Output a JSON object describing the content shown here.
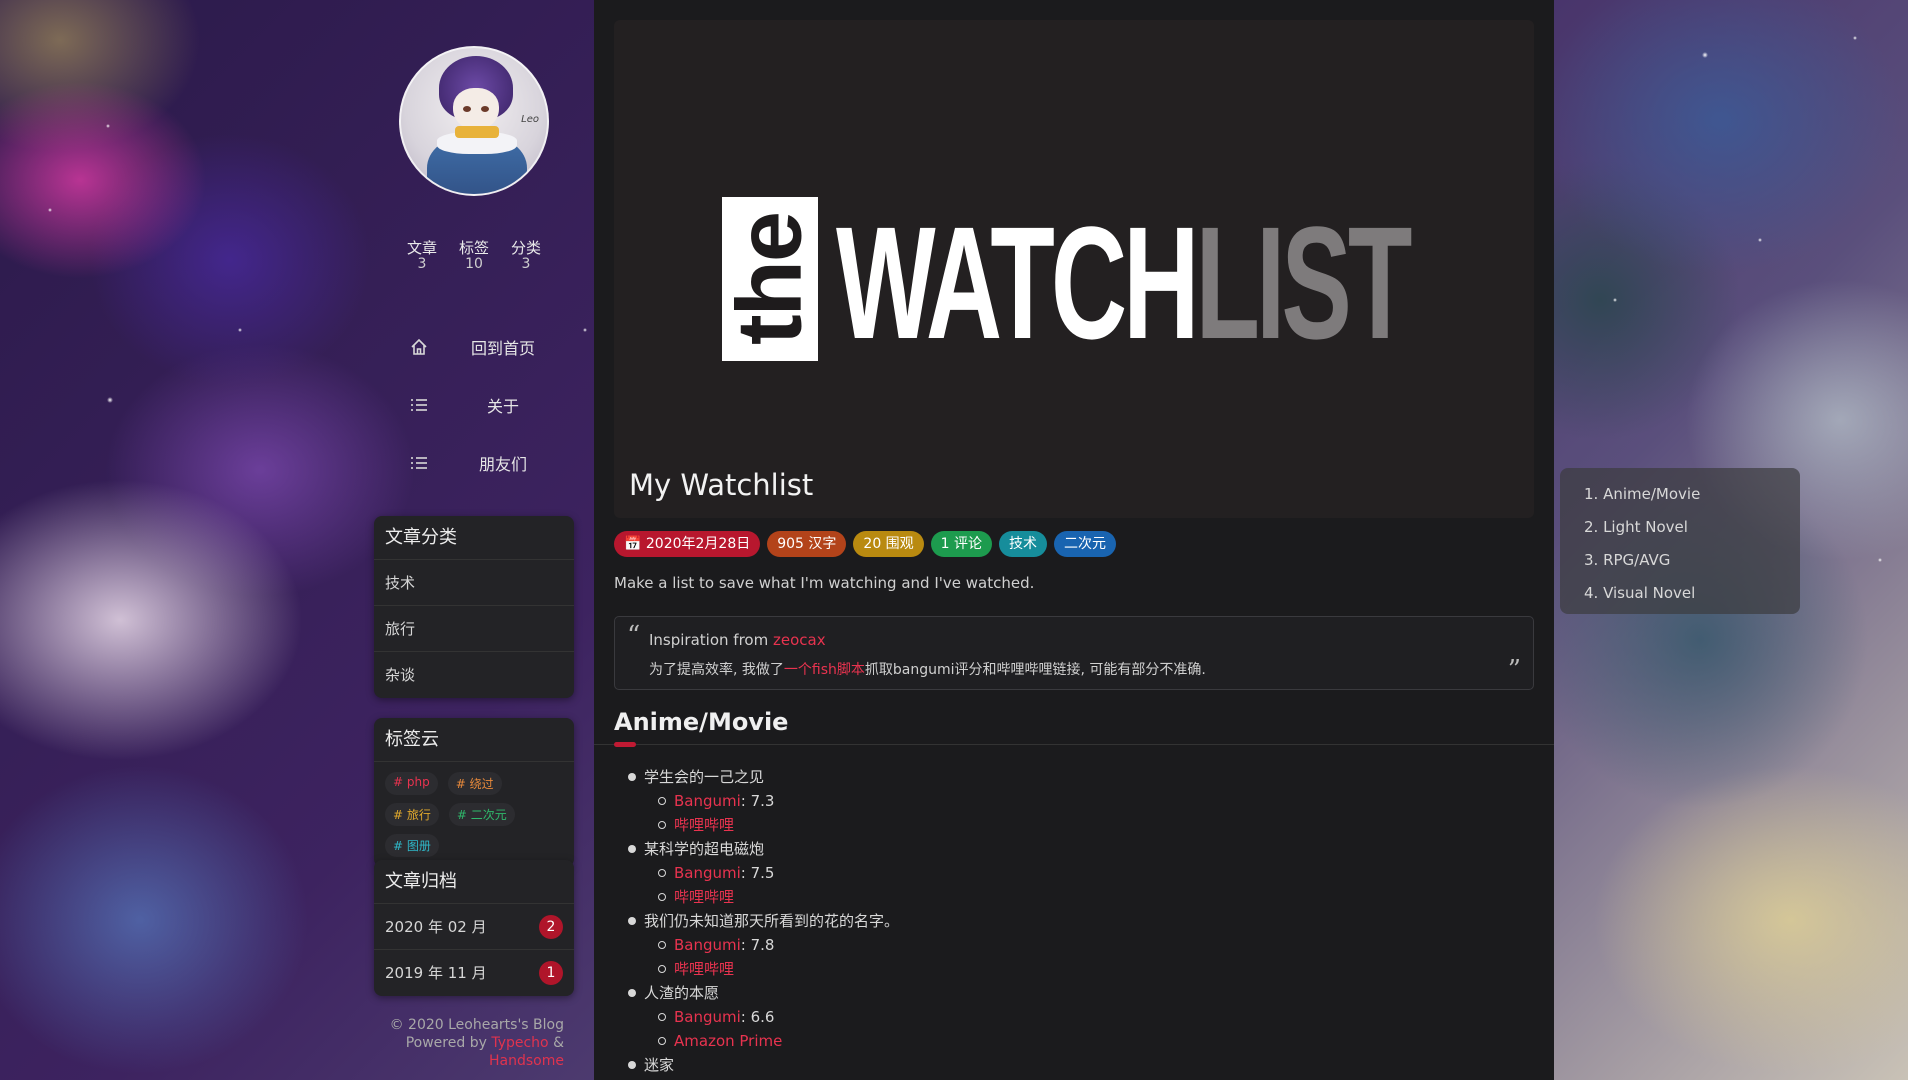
{
  "sidebar": {
    "stats": [
      {
        "label": "文章",
        "value": "3"
      },
      {
        "label": "标签",
        "value": "10"
      },
      {
        "label": "分类",
        "value": "3"
      }
    ],
    "menu": [
      {
        "label": "回到首页",
        "icon": "home-icon"
      },
      {
        "label": "关于",
        "icon": "list-icon"
      },
      {
        "label": "朋友们",
        "icon": "list-icon"
      }
    ],
    "categories": {
      "title": "文章分类",
      "items": [
        "技术",
        "旅行",
        "杂谈"
      ]
    },
    "tags": {
      "title": "标签云",
      "items": [
        {
          "label": "# php",
          "color": "#e8334f"
        },
        {
          "label": "# 绕过",
          "color": "#e98a3b"
        },
        {
          "label": "# 旅行",
          "color": "#e0a92c"
        },
        {
          "label": "# 二次元",
          "color": "#2fb86b"
        },
        {
          "label": "# 图册",
          "color": "#2fb7c8"
        }
      ]
    },
    "archive": {
      "title": "文章归档",
      "items": [
        {
          "label": "2020 年 02 月",
          "count": "2"
        },
        {
          "label": "2019 年 11 月",
          "count": "1"
        }
      ]
    },
    "footer": {
      "line1": "© 2020 Leohearts's Blog",
      "powered": "Powered by",
      "typecho": "Typecho",
      "amp": "&",
      "handsome": "Handsome"
    }
  },
  "post": {
    "hero": {
      "the": "the",
      "watch": "WATCH",
      "list": "LIST"
    },
    "title": "My Watchlist",
    "chips": [
      {
        "label": "📅 2020年2月28日",
        "color": "#b8172e"
      },
      {
        "label": "905 汉字",
        "color": "#b3431a"
      },
      {
        "label": "20 围观",
        "color": "#b98a10"
      },
      {
        "label": "1 评论",
        "color": "#1d9b4e"
      },
      {
        "label": "技术",
        "color": "#168d9b"
      },
      {
        "label": "二次元",
        "color": "#1964b0"
      }
    ],
    "description": "Make a list to save what I'm watching and I've watched.",
    "quote": {
      "line1_prefix": "Inspiration from ",
      "line1_link": "zeocax",
      "line2_prefix": "为了提高效率, 我做了",
      "line2_link": "一个fish脚本",
      "line2_suffix": "抓取bangumi评分和哔哩哔哩链接, 可能有部分不准确."
    },
    "section_title": "Anime/Movie",
    "list": [
      {
        "title": "学生会的一己之见",
        "subs": [
          {
            "link": "Bangumi",
            "text": ": 7.3"
          },
          {
            "link": "哔哩哔哩",
            "text": ""
          }
        ]
      },
      {
        "title": "某科学的超电磁炮",
        "subs": [
          {
            "link": "Bangumi",
            "text": ": 7.5"
          },
          {
            "link": "哔哩哔哩",
            "text": ""
          }
        ]
      },
      {
        "title": "我们仍未知道那天所看到的花的名字。",
        "subs": [
          {
            "link": "Bangumi",
            "text": ": 7.8"
          },
          {
            "link": "哔哩哔哩",
            "text": ""
          }
        ]
      },
      {
        "title": "人渣的本愿",
        "subs": [
          {
            "link": "Bangumi",
            "text": ": 6.6"
          },
          {
            "link": "Amazon Prime",
            "text": ""
          }
        ]
      },
      {
        "title": "迷家",
        "subs": []
      }
    ]
  },
  "toc": [
    "1. Anime/Movie",
    "2. Light Novel",
    "3. RPG/AVG",
    "4. Visual Novel"
  ],
  "colors": {
    "accent": "#e8334f",
    "main_bg": "#1b1b1d"
  }
}
